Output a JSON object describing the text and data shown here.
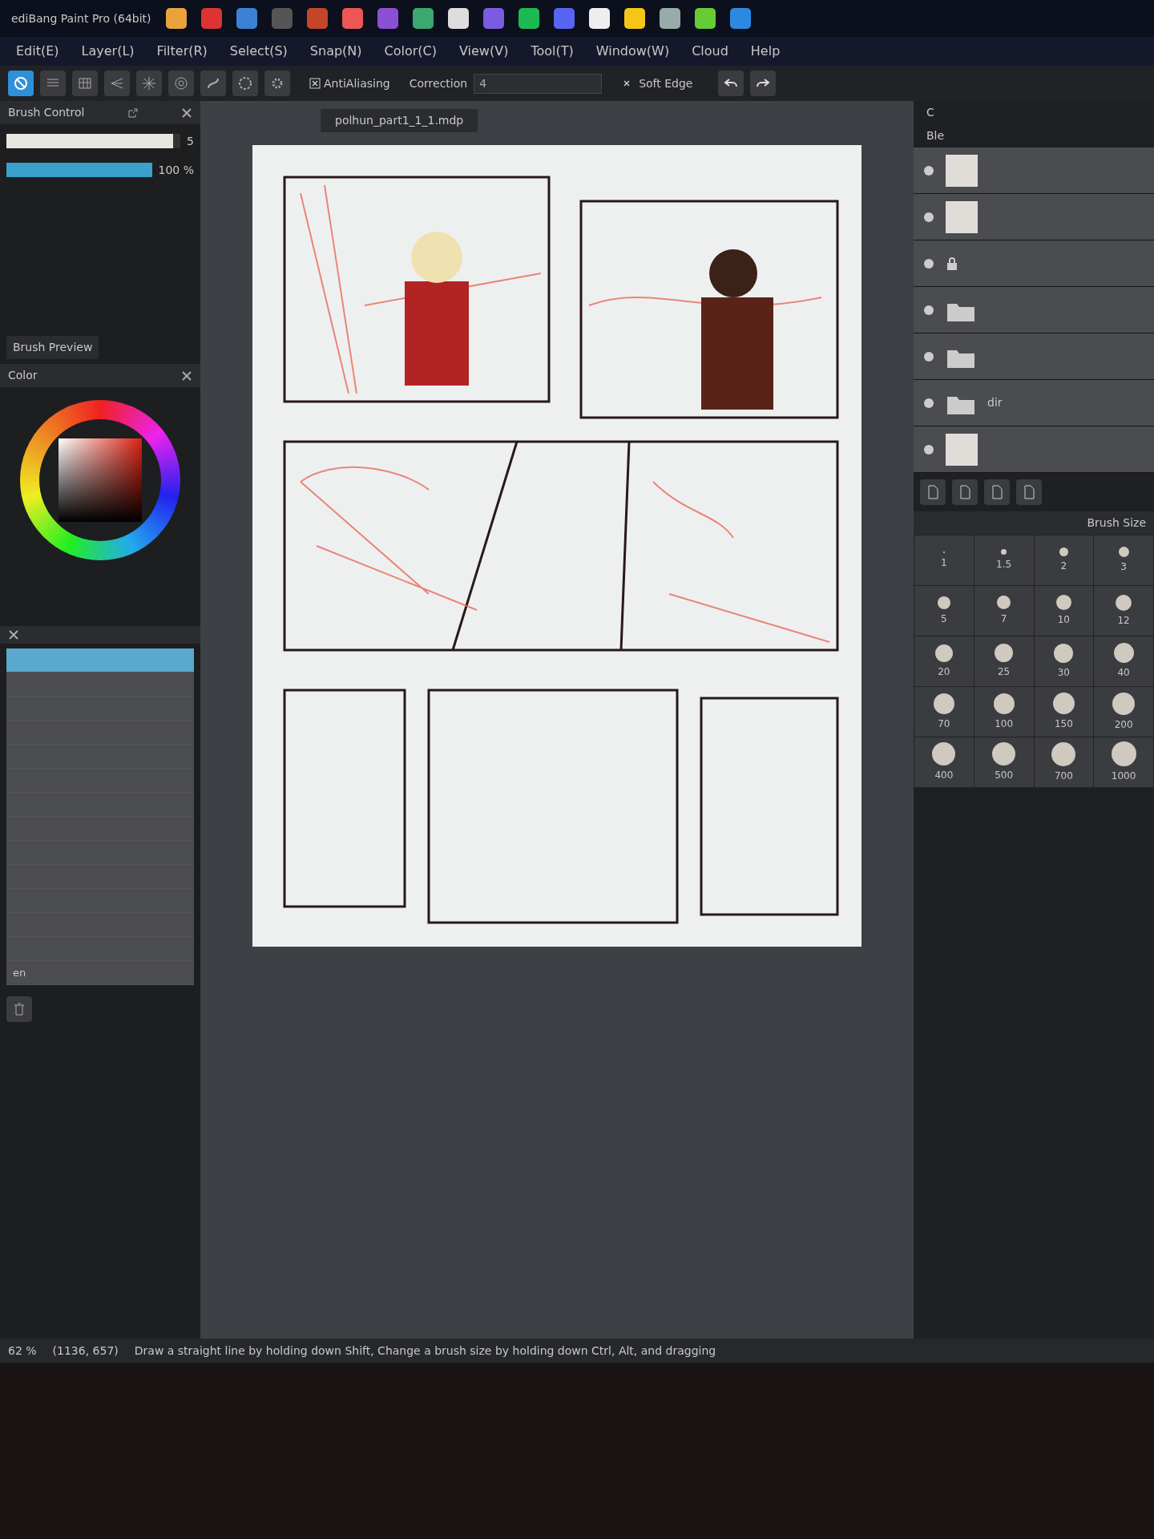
{
  "window": {
    "title": "ediBang Paint Pro (64bit)"
  },
  "menu": [
    "Edit(E)",
    "Layer(L)",
    "Filter(R)",
    "Select(S)",
    "Snap(N)",
    "Color(C)",
    "View(V)",
    "Tool(T)",
    "Window(W)",
    "Cloud",
    "Help"
  ],
  "toolbar": {
    "antialiasing": {
      "label": "AntiAliasing",
      "checked": true
    },
    "correction": {
      "label": "Correction",
      "value": "4"
    },
    "soft_edge": {
      "label": "Soft Edge",
      "checked": false
    }
  },
  "brush_control": {
    "title": "Brush Control",
    "size": {
      "level": 0.96,
      "reading": "5"
    },
    "opacity": {
      "level": 1,
      "reading": "100 %"
    }
  },
  "panel_tabs": [
    {
      "label": "Brush Preview",
      "selected": false
    }
  ],
  "color_panel": {
    "title": "Color"
  },
  "tool_list": {
    "rows": [
      {
        "selected": true
      },
      {
        "selected": false
      },
      {
        "selected": false
      },
      {
        "selected": false
      },
      {
        "selected": false
      },
      {
        "selected": false
      },
      {
        "selected": false
      },
      {
        "selected": false
      },
      {
        "selected": false
      },
      {
        "selected": false
      },
      {
        "selected": false
      },
      {
        "selected": false
      },
      {
        "selected": false
      },
      {
        "label": "en",
        "selected": false
      }
    ]
  },
  "document": {
    "tab": "polhun_part1_1_1.mdp"
  },
  "layer_panel": {
    "labels": [
      "C",
      "Ble"
    ],
    "layers": [
      {
        "kind": "layer"
      },
      {
        "kind": "layer"
      },
      {
        "kind": "locked"
      },
      {
        "kind": "folder"
      },
      {
        "kind": "folder"
      },
      {
        "kind": "folder",
        "label": "dir"
      },
      {
        "kind": "layer"
      }
    ]
  },
  "brush_size": {
    "title": "Brush Size",
    "sizes": [
      "1",
      "1.5",
      "2",
      "3",
      "5",
      "7",
      "10",
      "12",
      "20",
      "25",
      "30",
      "40",
      "70",
      "100",
      "150",
      "200",
      "400",
      "500",
      "700",
      "1000"
    ]
  },
  "status_bar": {
    "zoom": "62 %",
    "coords": "(1136, 657)",
    "hint": "Draw a straight line by holding down Shift, Change a brush size by holding down Ctrl, Alt, and dragging"
  }
}
